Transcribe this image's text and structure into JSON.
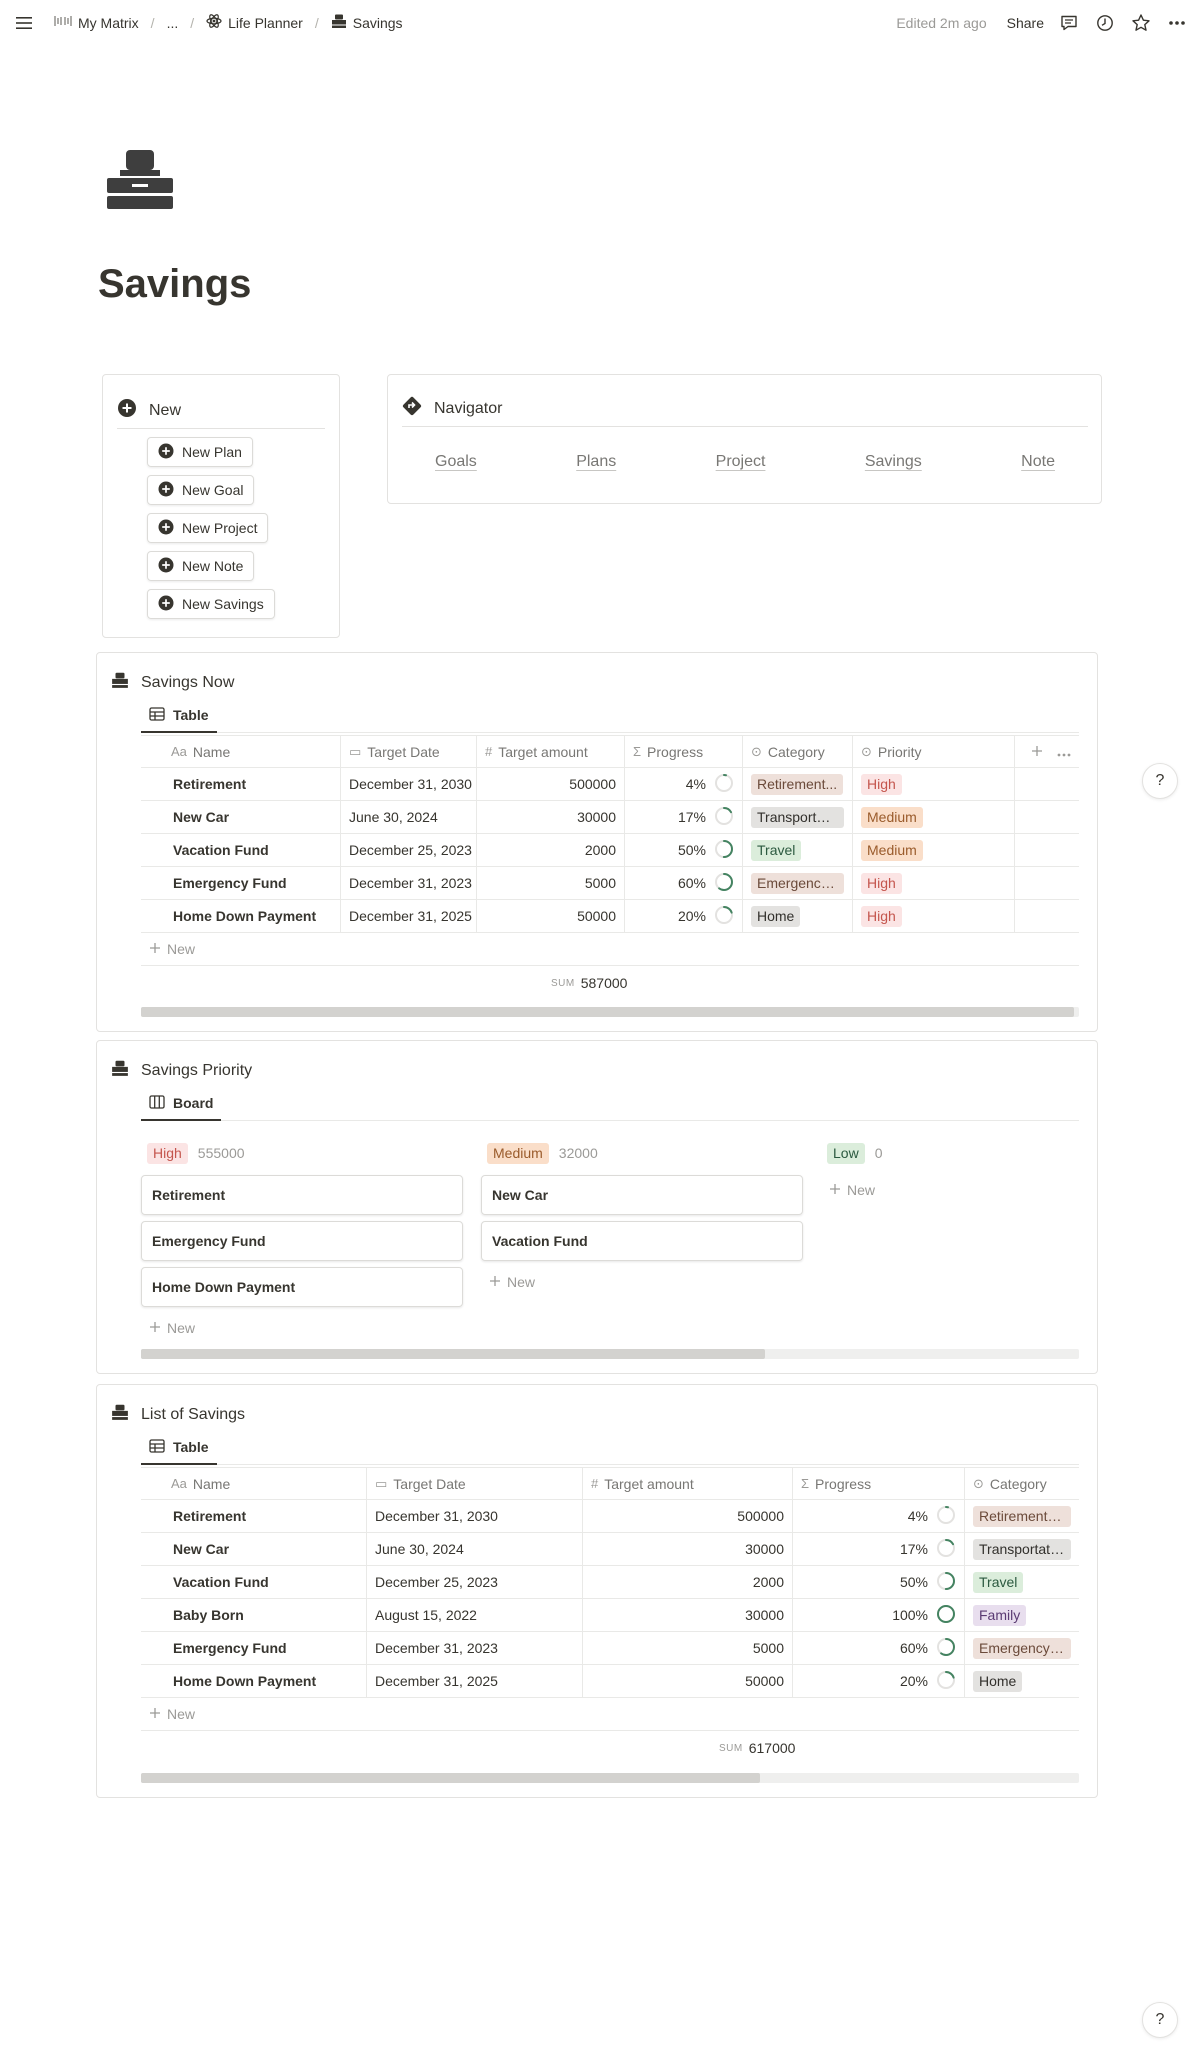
{
  "breadcrumb": {
    "workspace": "My Matrix",
    "ellipsis": "...",
    "parent": "Life Planner",
    "current": "Savings"
  },
  "topbar": {
    "edited": "Edited 2m ago",
    "share": "Share"
  },
  "page": {
    "title": "Savings",
    "icon": "cash-register-icon"
  },
  "new_callout": {
    "heading": "New",
    "buttons": [
      "New Plan",
      "New Goal",
      "New Project",
      "New Note",
      "New Savings"
    ]
  },
  "navigator": {
    "heading": "Navigator",
    "links": [
      "Goals",
      "Plans",
      "Project",
      "Savings",
      "Note"
    ]
  },
  "savings_now": {
    "title": "Savings Now",
    "view": "Table",
    "columns": [
      "Name",
      "Target Date",
      "Target amount",
      "Progress",
      "Category",
      "Priority"
    ],
    "rows": [
      {
        "name": "Retirement",
        "date": "December 31, 2030",
        "amount": "500000",
        "progress": "4%",
        "pct": 4,
        "category": "Retirement...",
        "cat_color": "brown",
        "priority": "High",
        "pri_color": "red"
      },
      {
        "name": "New Car",
        "date": "June 30, 2024",
        "amount": "30000",
        "progress": "17%",
        "pct": 17,
        "category": "Transportat...",
        "cat_color": "grey",
        "priority": "Medium",
        "pri_color": "orange"
      },
      {
        "name": "Vacation Fund",
        "date": "December 25, 2023",
        "amount": "2000",
        "progress": "50%",
        "pct": 50,
        "category": "Travel",
        "cat_color": "green",
        "priority": "Medium",
        "pri_color": "orange"
      },
      {
        "name": "Emergency Fund",
        "date": "December 31, 2023",
        "amount": "5000",
        "progress": "60%",
        "pct": 60,
        "category": "Emergency...",
        "cat_color": "brown",
        "priority": "High",
        "pri_color": "red"
      },
      {
        "name": "Home Down Payment",
        "date": "December 31, 2025",
        "amount": "50000",
        "progress": "20%",
        "pct": 20,
        "category": "Home",
        "cat_color": "grey",
        "priority": "High",
        "pri_color": "red"
      }
    ],
    "new_label": "New",
    "sum_label": "SUM",
    "sum_value": "587000",
    "scroll_fraction": 0.995
  },
  "savings_priority": {
    "title": "Savings Priority",
    "view": "Board",
    "groups": [
      {
        "label": "High",
        "color": "red",
        "count": "555000",
        "cards": [
          "Retirement",
          "Emergency Fund",
          "Home Down Payment"
        ]
      },
      {
        "label": "Medium",
        "color": "orange",
        "count": "32000",
        "cards": [
          "New Car",
          "Vacation Fund"
        ]
      },
      {
        "label": "Low",
        "color": "green",
        "count": "0",
        "cards": []
      }
    ],
    "new_label": "New",
    "scroll_fraction": 0.665
  },
  "list_of_savings": {
    "title": "List of Savings",
    "view": "Table",
    "columns": [
      "Name",
      "Target Date",
      "Target amount",
      "Progress",
      "Category"
    ],
    "rows": [
      {
        "name": "Retirement",
        "date": "December 31, 2030",
        "amount": "500000",
        "progress": "4%",
        "pct": 4,
        "category": "Retirement fund",
        "cat_color": "brown"
      },
      {
        "name": "New Car",
        "date": "June 30, 2024",
        "amount": "30000",
        "progress": "17%",
        "pct": 17,
        "category": "Transportation",
        "cat_color": "grey"
      },
      {
        "name": "Vacation Fund",
        "date": "December 25, 2023",
        "amount": "2000",
        "progress": "50%",
        "pct": 50,
        "category": "Travel",
        "cat_color": "green"
      },
      {
        "name": "Baby Born",
        "date": "August 15, 2022",
        "amount": "30000",
        "progress": "100%",
        "pct": 100,
        "category": "Family",
        "cat_color": "purple"
      },
      {
        "name": "Emergency Fund",
        "date": "December 31, 2023",
        "amount": "5000",
        "progress": "60%",
        "pct": 60,
        "category": "Emergency fund",
        "cat_color": "brown"
      },
      {
        "name": "Home Down Payment",
        "date": "December 31, 2025",
        "amount": "50000",
        "progress": "20%",
        "pct": 20,
        "category": "Home",
        "cat_color": "grey"
      }
    ],
    "new_label": "New",
    "sum_label": "SUM",
    "sum_value": "617000",
    "scroll_fraction": 0.66
  },
  "help_label": "?",
  "colors": {
    "text": "#37352f",
    "muted": "#9b9a97",
    "progress_ring": "#448361",
    "progress_track": "#e3e2e0"
  }
}
